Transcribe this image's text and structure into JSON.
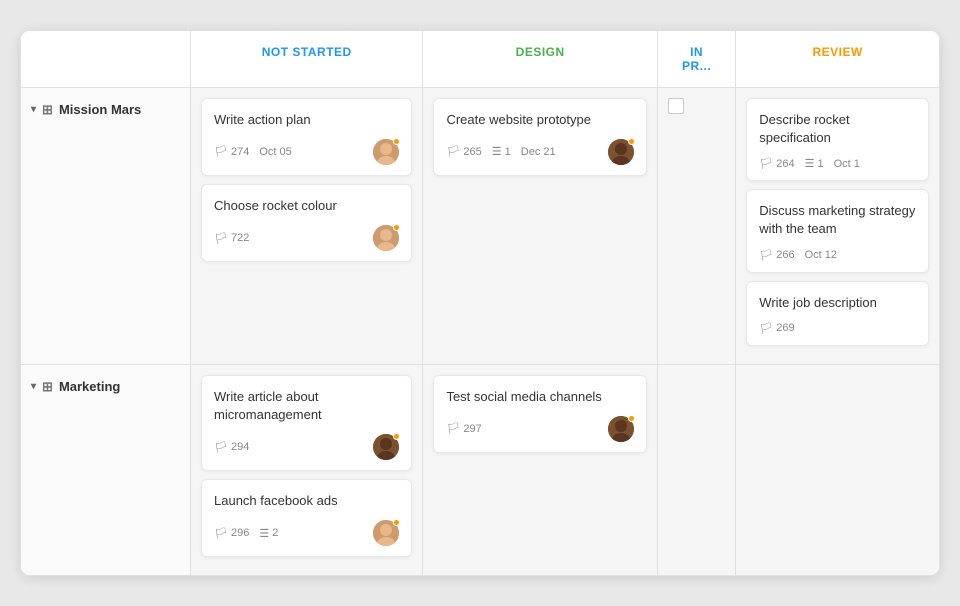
{
  "header": {
    "columns": [
      {
        "id": "group",
        "label": ""
      },
      {
        "id": "not-started",
        "label": "NOT STARTED",
        "color": "header-not-started"
      },
      {
        "id": "design",
        "label": "DESIGN",
        "color": "header-design"
      },
      {
        "id": "in-progress",
        "label": "IN PR...",
        "color": "header-in-progress"
      },
      {
        "id": "review",
        "label": "REVIEW",
        "color": "header-review"
      }
    ]
  },
  "groups": [
    {
      "id": "mission-mars",
      "label": "Mission Mars",
      "not_started_cards": [
        {
          "id": "card-1",
          "title": "Write action plan",
          "task_id": "274",
          "date": "Oct 05",
          "has_avatar": true,
          "avatar_type": "brown",
          "has_urgency": true
        },
        {
          "id": "card-2",
          "title": "Choose rocket colour",
          "task_id": "722",
          "date": null,
          "has_avatar": true,
          "avatar_type": "brown",
          "has_urgency": true
        }
      ],
      "design_cards": [
        {
          "id": "card-3",
          "title": "Create website prototype",
          "task_id": "265",
          "subtasks": "1",
          "date": "Dec 21",
          "has_avatar": true,
          "avatar_type": "dark",
          "has_urgency": true
        }
      ],
      "in_progress_cards": [],
      "review_cards": [
        {
          "id": "card-5",
          "title": "Describe rocket specification",
          "task_id": "264",
          "subtasks": "1",
          "date": "Oct 1"
        },
        {
          "id": "card-6",
          "title": "Discuss marketing strategy with the team",
          "task_id": "266",
          "date": "Oct 12"
        },
        {
          "id": "card-7",
          "title": "Write job description",
          "task_id": "269",
          "date": null
        }
      ]
    },
    {
      "id": "marketing",
      "label": "Marketing",
      "not_started_cards": [
        {
          "id": "card-8",
          "title": "Write article about micromanagement",
          "task_id": "294",
          "date": null,
          "has_avatar": true,
          "avatar_type": "dark",
          "has_urgency": true
        },
        {
          "id": "card-9",
          "title": "Launch facebook ads",
          "task_id": "296",
          "subtasks": "2",
          "date": null,
          "has_avatar": true,
          "avatar_type": "brown",
          "has_urgency": true
        }
      ],
      "design_cards": [
        {
          "id": "card-10",
          "title": "Test social media channels",
          "task_id": "297",
          "date": null,
          "has_avatar": true,
          "avatar_type": "dark",
          "has_urgency": true
        }
      ],
      "in_progress_cards": [],
      "review_cards": []
    }
  ]
}
